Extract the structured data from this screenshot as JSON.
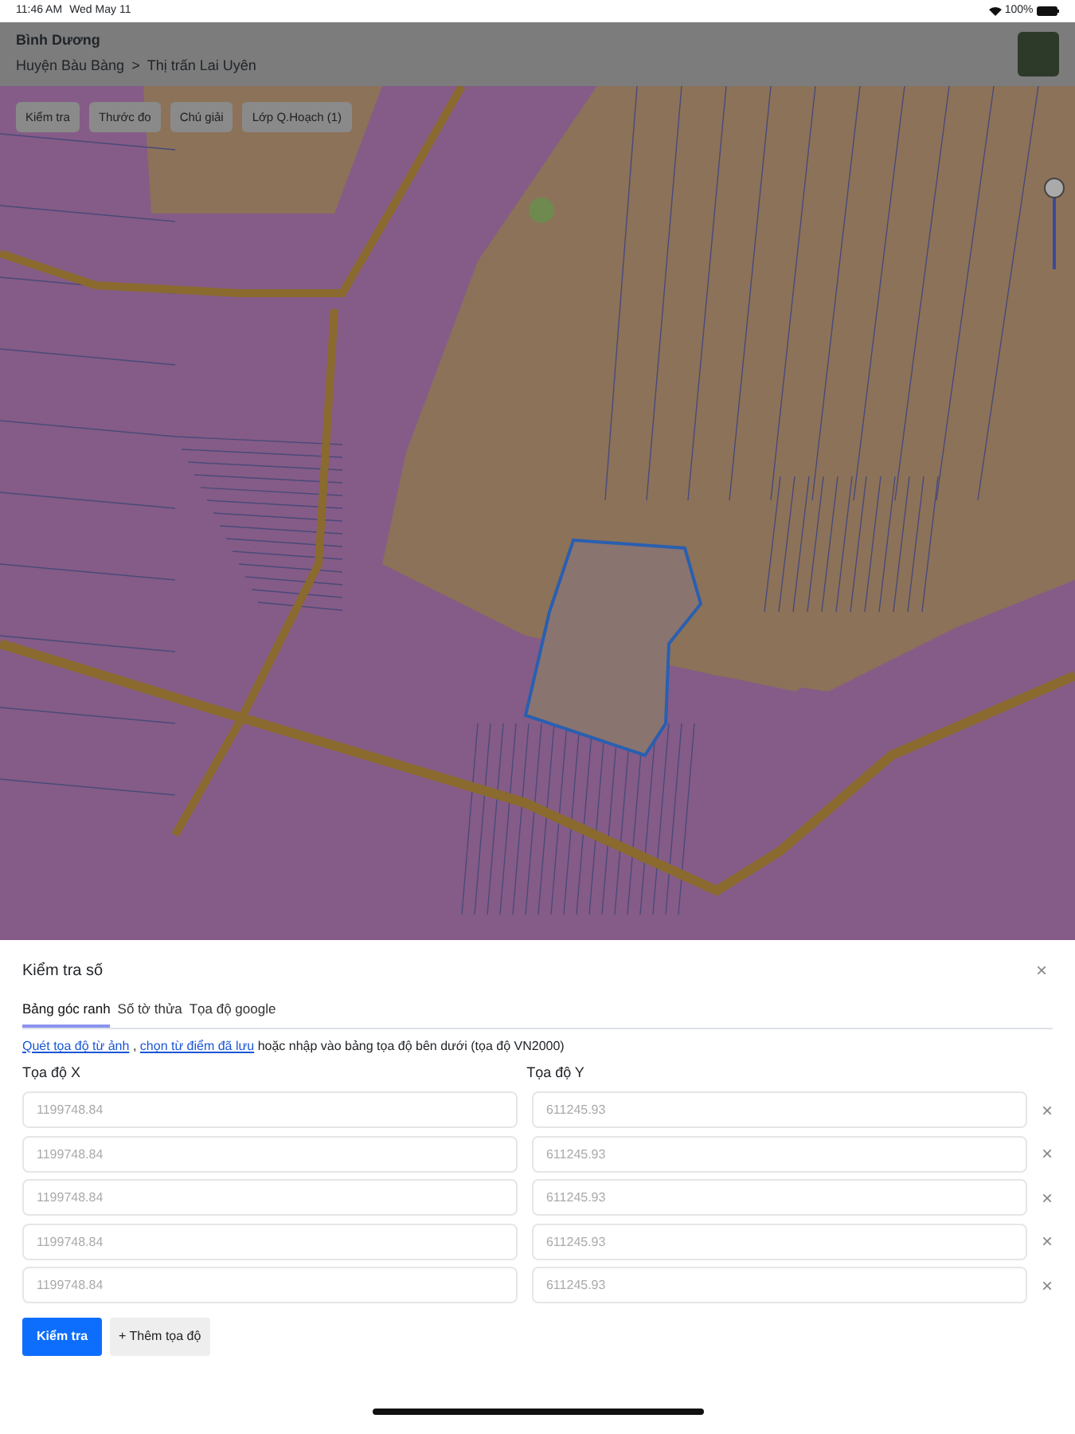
{
  "status_bar": {
    "time": "11:46 AM",
    "date": "Wed May 11",
    "battery": "100%"
  },
  "header": {
    "title": "Bình Dương",
    "breadcrumb": [
      "Huyện Bàu Bàng",
      "Thị trấn Lai Uyên"
    ],
    "separator": ">"
  },
  "map_toolbar": [
    "Kiểm tra",
    "Thước đo",
    "Chú giải",
    "Lớp Q.Hoạch (1)"
  ],
  "panel": {
    "title": "Kiểm tra số",
    "close": "×",
    "tabs": [
      {
        "label": "Bảng góc ranh",
        "selected": true
      },
      {
        "label": "Số tờ thửa",
        "selected": false
      },
      {
        "label": "Tọa độ google",
        "selected": false
      }
    ],
    "hint": {
      "links": [
        "Quét tọa độ từ ảnh",
        "chọn từ điểm đã lưu"
      ],
      "separator": ",",
      "text": "hoặc nhập vào bảng tọa độ bên dưới (tọa độ VN2000)"
    },
    "columns": [
      "Tọa độ X",
      "Tọa độ Y"
    ],
    "rows": [
      {
        "x_placeholder": "1199748.84",
        "y_placeholder": "611245.93",
        "remove": "×"
      },
      {
        "x_placeholder": "1199748.84",
        "y_placeholder": "611245.93",
        "remove": "×"
      },
      {
        "x_placeholder": "1199748.84",
        "y_placeholder": "611245.93",
        "remove": "×"
      },
      {
        "x_placeholder": "1199748.84",
        "y_placeholder": "611245.93",
        "remove": "×"
      },
      {
        "x_placeholder": "1199748.84",
        "y_placeholder": "611245.93",
        "remove": "×"
      }
    ],
    "submit": "Kiểm tra",
    "add": "+ Thêm tọa độ"
  }
}
